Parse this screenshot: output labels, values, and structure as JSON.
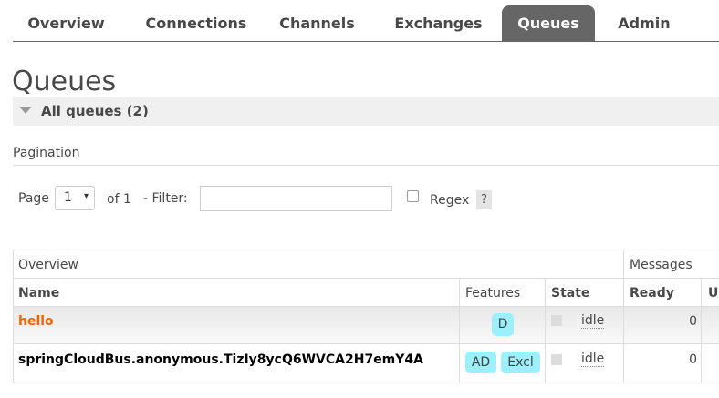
{
  "nav": {
    "tabs": [
      {
        "label": "Overview",
        "active": false
      },
      {
        "label": "Connections",
        "active": false
      },
      {
        "label": "Channels",
        "active": false
      },
      {
        "label": "Exchanges",
        "active": false
      },
      {
        "label": "Queues",
        "active": true
      },
      {
        "label": "Admin",
        "active": false
      }
    ]
  },
  "page": {
    "title": "Queues",
    "section_label": "All queues (2)"
  },
  "pagination": {
    "heading": "Pagination",
    "page_label": "Page",
    "page_value": "1",
    "page_arrow": "▾",
    "of_label": "of 1",
    "filter_label": "- Filter:",
    "filter_value": "",
    "regex_label": "Regex",
    "help_label": "?"
  },
  "table": {
    "group_overview": "Overview",
    "group_messages": "Messages",
    "col_name": "Name",
    "col_features": "Features",
    "col_state": "State",
    "col_ready": "Ready",
    "col_unacked": "U",
    "rows": [
      {
        "name": "hello",
        "name_color": "#f06500",
        "features": [
          "D"
        ],
        "state": "idle",
        "ready": "0"
      },
      {
        "name": "springCloudBus.anonymous.TizIy8ycQ6WVCA2H7emY4A",
        "name_color": "#000000",
        "features": [
          "AD",
          "Excl"
        ],
        "state": "idle",
        "ready": "0"
      }
    ]
  },
  "colors": {
    "accent_tab": "#666666",
    "feature_badge": "#99eeff",
    "link_orange": "#f06500"
  }
}
